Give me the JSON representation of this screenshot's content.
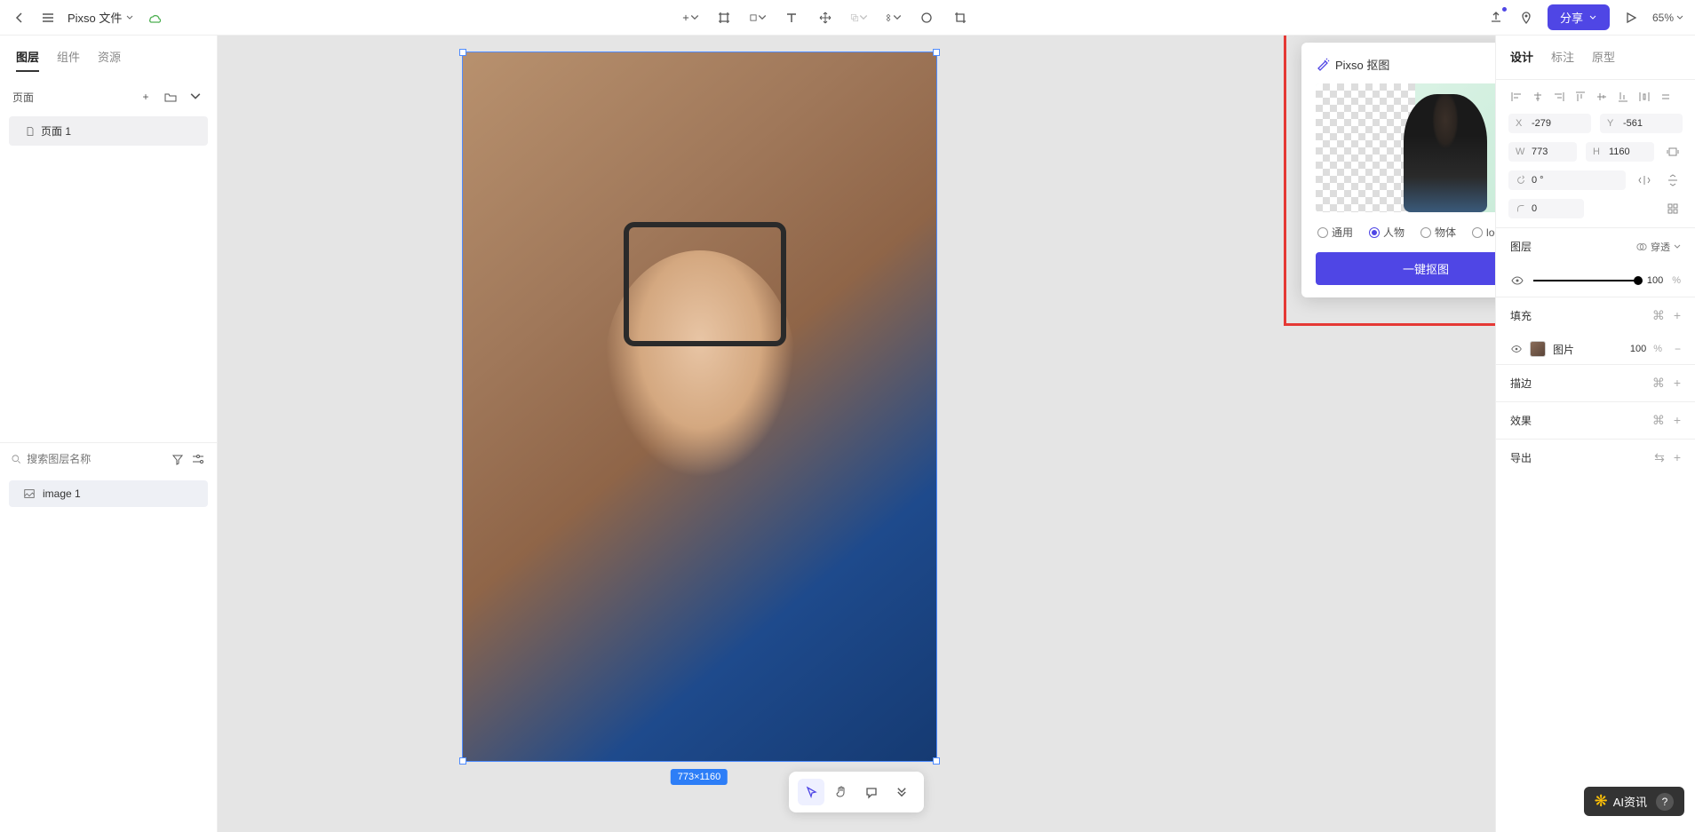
{
  "topbar": {
    "file_title": "Pixso 文件",
    "share_label": "分享",
    "zoom_label": "65%"
  },
  "left": {
    "tabs": [
      "图层",
      "组件",
      "资源"
    ],
    "active_tab": 0,
    "pages_label": "页面",
    "pages": [
      {
        "name": "页面 1"
      }
    ],
    "search_placeholder": "搜索图层名称",
    "layers": [
      {
        "name": "image 1"
      }
    ]
  },
  "canvas": {
    "selection_dim": "773×1160"
  },
  "cutout_panel": {
    "title": "Pixso 抠图",
    "options": [
      "通用",
      "人物",
      "物体",
      "logo"
    ],
    "selected": 1,
    "button_label": "一键抠图"
  },
  "right": {
    "tabs": [
      "设计",
      "标注",
      "原型"
    ],
    "active_tab": 0,
    "x_label": "X",
    "x_value": "-279",
    "y_label": "Y",
    "y_value": "-561",
    "w_label": "W",
    "w_value": "773",
    "h_label": "H",
    "h_value": "1160",
    "rotation_value": "0 °",
    "radius_value": "0",
    "layer_section": "图层",
    "passthrough": "穿透",
    "opacity_value": "100",
    "opacity_unit": "%",
    "fill_section": "填充",
    "fill_label": "图片",
    "fill_opacity": "100",
    "stroke_section": "描边",
    "effect_section": "效果",
    "export_section": "导出"
  },
  "badge": {
    "text": "AI资讯",
    "help": "?"
  }
}
